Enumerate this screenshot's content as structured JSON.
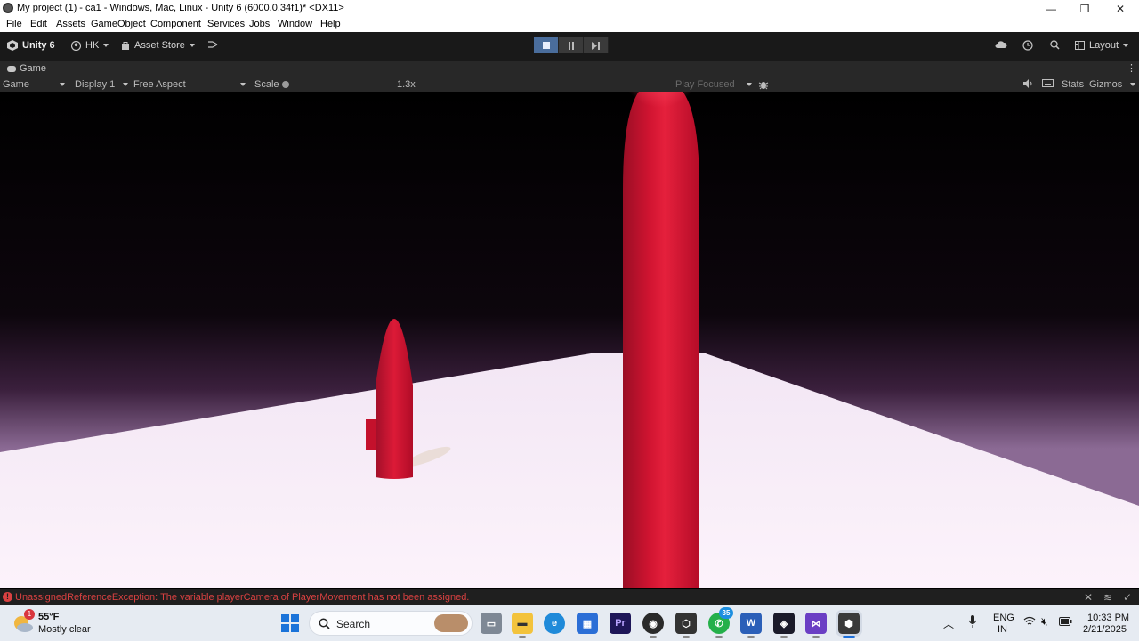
{
  "window": {
    "title": "My project (1) - ca1 - Windows, Mac, Linux - Unity 6 (6000.0.34f1)* <DX11>",
    "controls": {
      "minimize": "—",
      "restore": "❐",
      "close": "✕"
    }
  },
  "menu": [
    "File",
    "Edit",
    "Assets",
    "GameObject",
    "Component",
    "Services",
    "Jobs",
    "Window",
    "Help"
  ],
  "toolbar": {
    "brand": "Unity 6",
    "account": "HK",
    "asset_store": "Asset Store",
    "layout": "Layout"
  },
  "tab": {
    "label": "Game"
  },
  "game_toolbar": {
    "mode": "Game",
    "display": "Display 1",
    "aspect": "Free Aspect",
    "scale_label": "Scale",
    "scale_value": "1.3x",
    "play_focused": "Play Focused",
    "stats": "Stats",
    "gizmos": "Gizmos"
  },
  "console": {
    "message": "UnassignedReferenceException: The variable playerCamera of PlayerMovement has not been assigned."
  },
  "taskbar": {
    "weather_temp": "55°F",
    "weather_desc": "Mostly clear",
    "weather_badge": "1",
    "search": "Search",
    "whatsapp_badge": "35",
    "lang1": "ENG",
    "lang2": "IN",
    "time": "10:33 PM",
    "date": "2/21/2025"
  },
  "colors": {
    "accent_play": "#4a6d9c",
    "error": "#d94141",
    "capsule": "#c8102e",
    "floor": "#f7e9f7"
  }
}
